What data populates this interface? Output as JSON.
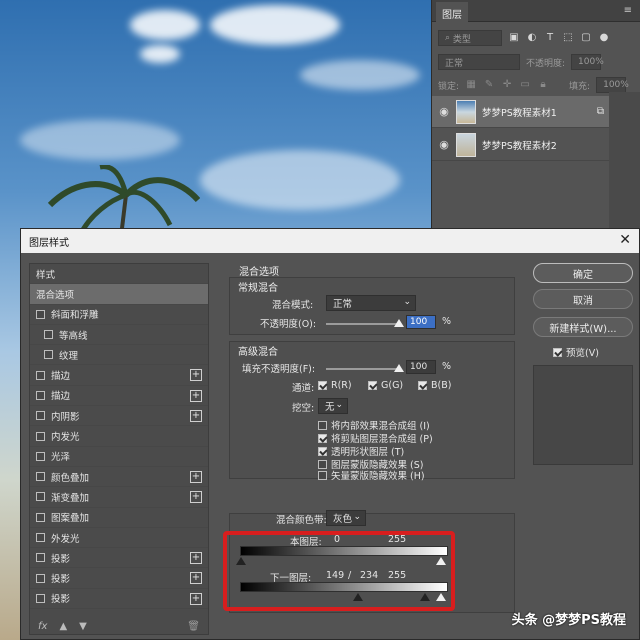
{
  "layers_panel": {
    "tab": "图层",
    "menu_icon": "menu-icon",
    "filter_placeholder": "类型",
    "blend_mode": "正常",
    "opacity_label": "不透明度:",
    "opacity_value": "100%",
    "lock_label": "锁定:",
    "fill_label": "填充:",
    "fill_value": "100%",
    "layers": [
      {
        "name": "梦梦PS教程素材1",
        "selected": true
      },
      {
        "name": "梦梦PS教程素材2",
        "selected": false
      }
    ]
  },
  "dialog": {
    "title": "图层样式",
    "styles": [
      {
        "label": "样式",
        "checkbox": false,
        "plus": false,
        "selected": false,
        "sub": false
      },
      {
        "label": "混合选项",
        "checkbox": false,
        "plus": false,
        "selected": true,
        "sub": false
      },
      {
        "label": "斜面和浮雕",
        "checkbox": true,
        "plus": false,
        "selected": false,
        "sub": false
      },
      {
        "label": "等高线",
        "checkbox": true,
        "plus": false,
        "selected": false,
        "sub": true
      },
      {
        "label": "纹理",
        "checkbox": true,
        "plus": false,
        "selected": false,
        "sub": true
      },
      {
        "label": "描边",
        "checkbox": true,
        "plus": true,
        "selected": false,
        "sub": false
      },
      {
        "label": "描边",
        "checkbox": true,
        "plus": true,
        "selected": false,
        "sub": false
      },
      {
        "label": "内阴影",
        "checkbox": true,
        "plus": true,
        "selected": false,
        "sub": false
      },
      {
        "label": "内发光",
        "checkbox": true,
        "plus": false,
        "selected": false,
        "sub": false
      },
      {
        "label": "光泽",
        "checkbox": true,
        "plus": false,
        "selected": false,
        "sub": false
      },
      {
        "label": "颜色叠加",
        "checkbox": true,
        "plus": true,
        "selected": false,
        "sub": false
      },
      {
        "label": "渐变叠加",
        "checkbox": true,
        "plus": true,
        "selected": false,
        "sub": false
      },
      {
        "label": "图案叠加",
        "checkbox": true,
        "plus": false,
        "selected": false,
        "sub": false
      },
      {
        "label": "外发光",
        "checkbox": true,
        "plus": false,
        "selected": false,
        "sub": false
      },
      {
        "label": "投影",
        "checkbox": true,
        "plus": true,
        "selected": false,
        "sub": false
      },
      {
        "label": "投影",
        "checkbox": true,
        "plus": true,
        "selected": false,
        "sub": false
      },
      {
        "label": "投影",
        "checkbox": true,
        "plus": true,
        "selected": false,
        "sub": false
      }
    ],
    "fx_label": "fx",
    "blending": {
      "section_title": "混合选项",
      "general_title": "常规混合",
      "blend_mode_label": "混合模式:",
      "blend_mode_value": "正常",
      "opacity_label": "不透明度(O):",
      "opacity_value": "100",
      "opacity_unit": "%",
      "advanced_title": "高级混合",
      "fill_label": "填充不透明度(F):",
      "fill_value": "100",
      "fill_unit": "%",
      "channels_label": "通道:",
      "channel_r": "R(R)",
      "channel_g": "G(G)",
      "channel_b": "B(B)",
      "knockout_label": "挖空:",
      "knockout_value": "无",
      "options": [
        {
          "label": "将内部效果混合成组 (I)",
          "checked": false
        },
        {
          "label": "将剪贴图层混合成组 (P)",
          "checked": true
        },
        {
          "label": "透明形状图层 (T)",
          "checked": true
        },
        {
          "label": "图层蒙版隐藏效果 (S)",
          "checked": false
        },
        {
          "label": "矢量蒙版隐藏效果 (H)",
          "checked": false
        }
      ],
      "blend_if_label": "混合颜色带:",
      "blend_if_value": "灰色",
      "this_layer_label": "本图层:",
      "this_layer_low": "0",
      "this_layer_high": "255",
      "underlying_label": "下一图层:",
      "underlying_low": "149",
      "underlying_sep": "/",
      "underlying_mid": "234",
      "underlying_high": "255"
    },
    "buttons": {
      "ok": "确定",
      "cancel": "取消",
      "new_style": "新建样式(W)...",
      "preview": "预览(V)"
    }
  },
  "watermark": "头条 @梦梦PS教程",
  "colors": {
    "highlight_frame": "#d81e1e",
    "selected_value_bg": "#3c6fc4"
  }
}
